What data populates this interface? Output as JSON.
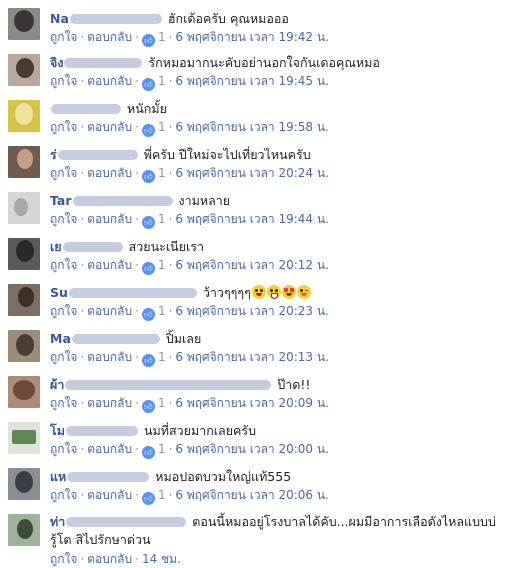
{
  "labels": {
    "like": "ถูกใจ",
    "reply": "ตอบกลับ",
    "separator": "·"
  },
  "colors": {
    "name": "#365899",
    "meta": "#90949c",
    "like_badge": "#5890ff",
    "blurred_name": "#c7cde0"
  },
  "comments": [
    {
      "name_visible": "Na",
      "text": "ฮักเด้อครับ คุณหมอออ",
      "likes": "1",
      "time": "6 พฤศจิกายน เวลา 19:42 น."
    },
    {
      "name_visible": "จิง",
      "text": "รักหมอมากนะคับอย่านอกใจกันเดอคุณหมอ",
      "likes": "1",
      "time": "6 พฤศจิกายน เวลา 19:45 น."
    },
    {
      "name_visible": "",
      "text": "หนักมั้ย",
      "likes": "1",
      "time": "6 พฤศจิกายน เวลา 19:58 น."
    },
    {
      "name_visible": "ร่",
      "text": "พี่ครับ ปีใหม่จะไปเที่ยวไหนครับ",
      "likes": "1",
      "time": "6 พฤศจิกายน เวลา 20:24 น."
    },
    {
      "name_visible": "Tar",
      "text": "งามหลาย",
      "likes": "1",
      "time": "6 พฤศจิกายน เวลา 19:44 น."
    },
    {
      "name_visible": "เย",
      "text": "สวยนะเนียเรา",
      "likes": "1",
      "time": "6 พฤศจิกายน เวลา 20:12 น."
    },
    {
      "name_visible": "Su",
      "text": "ว้าวๆๆๆๆ",
      "emojis": [
        "smile-emoji",
        "grin-emoji",
        "heart-eyes-emoji",
        "wink-emoji"
      ],
      "likes": "1",
      "time": "6 พฤศจิกายน เวลา 20:23 น."
    },
    {
      "name_visible": "Ma",
      "text": "ปิ้มเลย",
      "likes": "1",
      "time": "6 พฤศจิกายน เวลา 20:13 น."
    },
    {
      "name_visible": "ผ้า",
      "text": "ป๊าด!!",
      "likes": "1",
      "time": "6 พฤศจิกายน เวลา 20:09 น."
    },
    {
      "name_visible": "โม",
      "text": "นมที่สวยมากเลยครับ",
      "likes": "1",
      "time": "6 พฤศจิกายน เวลา 20:00 น."
    },
    {
      "name_visible": "แห",
      "text": "หมอปอดบวมใหญ่แท้555",
      "likes": "1",
      "time": "6 พฤศจิกายน เวลา 20:06 น."
    },
    {
      "name_visible": "ท่า",
      "text": "ตอนนี้หมออยู่โรงบาลได้คับ...ผมมีอาการเลือดังไหลแบบบ่รู้โต สิไปรักษาด่วน",
      "likes": "",
      "time": "14 ชม."
    }
  ]
}
